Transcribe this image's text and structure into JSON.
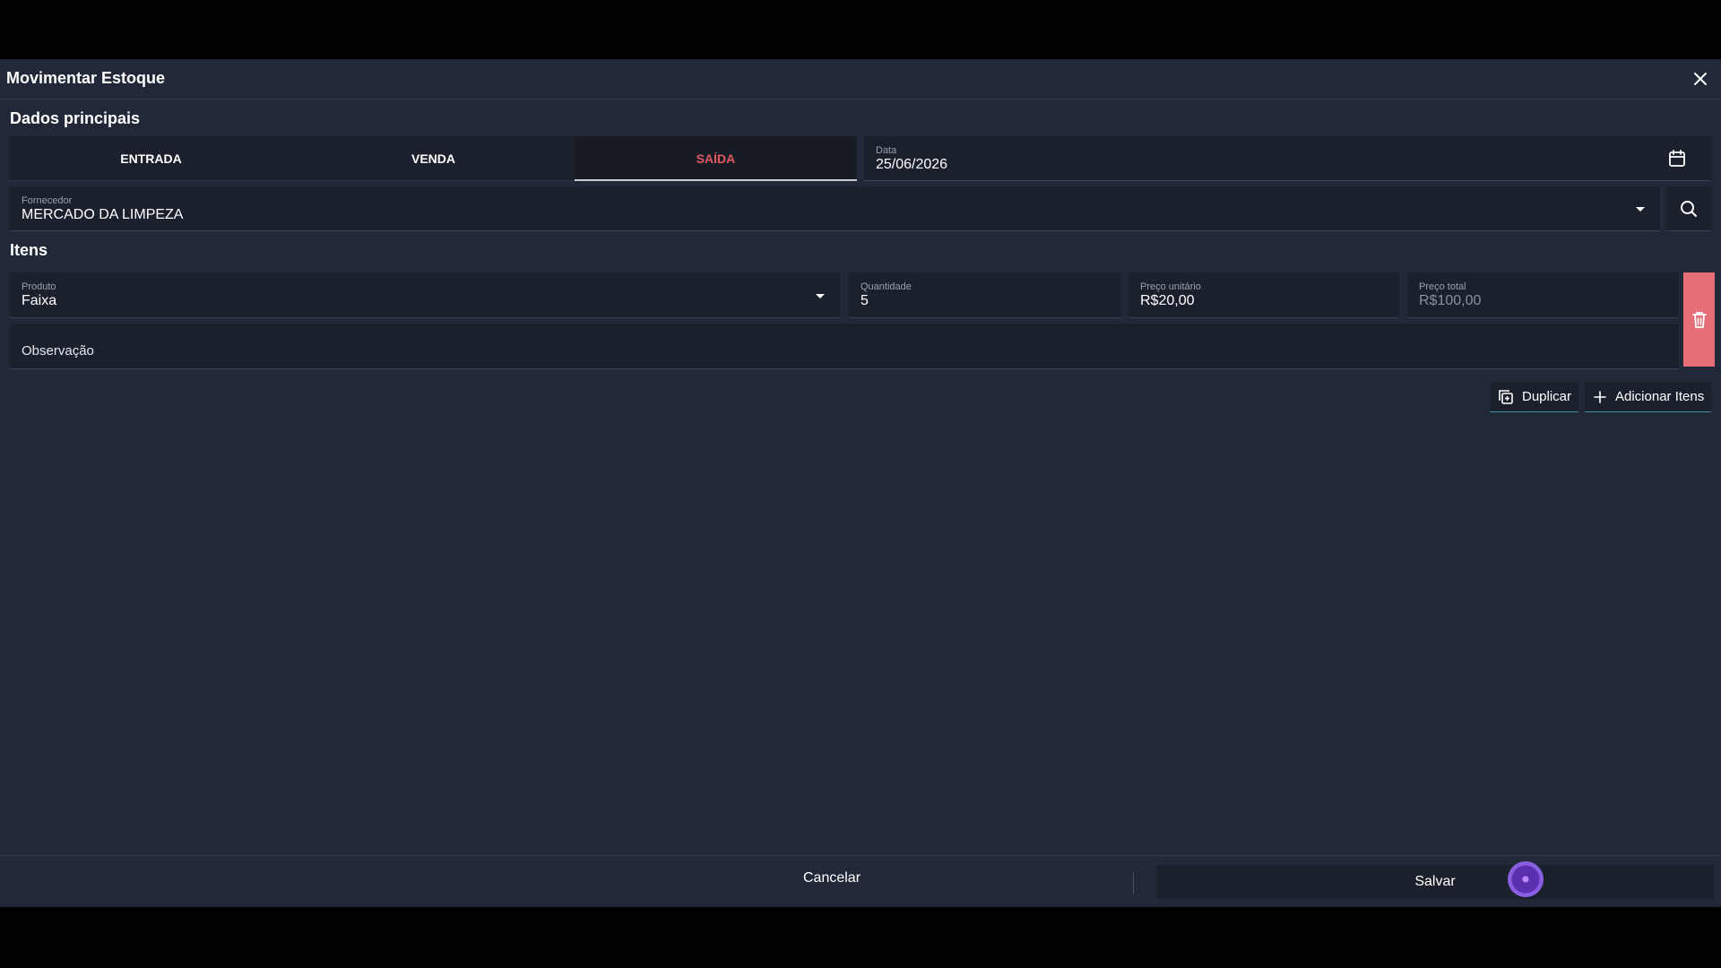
{
  "modal": {
    "title": "Movimentar Estoque",
    "close_icon": "close-icon"
  },
  "main_section": {
    "title": "Dados principais",
    "tabs": [
      {
        "label": "ENTRADA",
        "active": false
      },
      {
        "label": "VENDA",
        "active": false
      },
      {
        "label": "SAÍDA",
        "active": true
      }
    ],
    "date": {
      "label": "Data",
      "value": "25/06/2026",
      "icon": "calendar-icon"
    },
    "supplier": {
      "label": "Fornecedor",
      "value": "MERCADO DA LIMPEZA",
      "icon": "chevron-down-icon",
      "search_icon": "search-icon"
    }
  },
  "items_section": {
    "title": "Itens",
    "item": {
      "product": {
        "label": "Produto",
        "value": "Faixa"
      },
      "quantity": {
        "label": "Quantidade",
        "value": "5"
      },
      "unit_price": {
        "label": "Preço unitário",
        "value": "R$20,00"
      },
      "total_price": {
        "label": "Preço total",
        "value": "R$100,00"
      },
      "note": {
        "placeholder": "Observação"
      },
      "delete_icon": "trash-icon"
    },
    "duplicate_label": "Duplicar",
    "add_items_label": "Adicionar Itens"
  },
  "footer": {
    "cancel_label": "Cancelar",
    "save_label": "Salvar"
  },
  "colors": {
    "background": "#212938",
    "field": "#1b212c",
    "active_tab": "#e05a62",
    "delete": "#e56e78"
  }
}
